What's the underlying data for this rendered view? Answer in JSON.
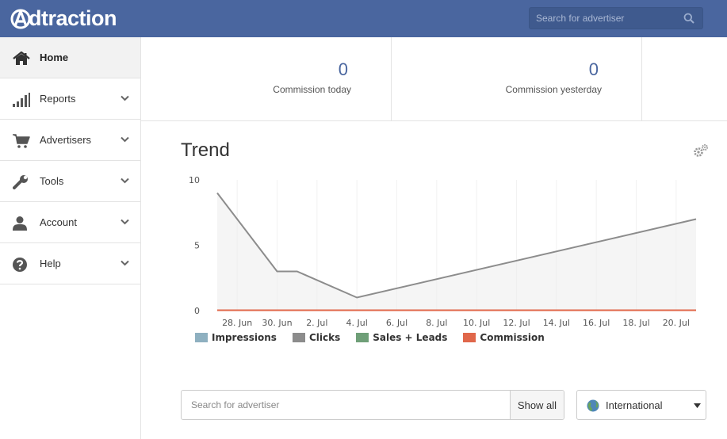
{
  "header": {
    "logo_text": "dtraction",
    "search_placeholder": "Search for advertiser",
    "accent_color": "#4a669f"
  },
  "sidebar": {
    "items": [
      {
        "label": "Home",
        "icon": "home-icon",
        "active": true
      },
      {
        "label": "Reports",
        "icon": "bar-signal-icon"
      },
      {
        "label": "Advertisers",
        "icon": "cart-icon"
      },
      {
        "label": "Tools",
        "icon": "wrench-icon"
      },
      {
        "label": "Account",
        "icon": "user-icon"
      },
      {
        "label": "Help",
        "icon": "question-icon"
      }
    ]
  },
  "stats": [
    {
      "value": "0",
      "label": "Commission today"
    },
    {
      "value": "0",
      "label": "Commission yesterday"
    }
  ],
  "trend": {
    "title": "Trend"
  },
  "chart_data": {
    "type": "area",
    "ylim": [
      0,
      10
    ],
    "yticks": [
      "10",
      "5",
      "0"
    ],
    "x_tick_labels": [
      "28. Jun",
      "30. Jun",
      "2. Jul",
      "4. Jul",
      "6. Jul",
      "8. Jul",
      "10. Jul",
      "12. Jul",
      "14. Jul",
      "16. Jul",
      "18. Jul",
      "20. Jul"
    ],
    "grid": false,
    "legend_position": "bottom-left",
    "series": [
      {
        "name": "Impressions",
        "color": "#8eb0c0",
        "points": []
      },
      {
        "name": "Clicks",
        "color": "#8c8c8c",
        "points": [
          {
            "x": "27. Jun",
            "y": 9
          },
          {
            "x": "30. Jun",
            "y": 3
          },
          {
            "x": "1. Jul",
            "y": 3
          },
          {
            "x": "4. Jul",
            "y": 1
          },
          {
            "x": "21. Jul",
            "y": 7
          }
        ]
      },
      {
        "name": "Sales + Leads",
        "color": "#6f9f78",
        "points": []
      },
      {
        "name": "Commission",
        "color": "#e0674a",
        "points": [
          {
            "x": "27. Jun",
            "y": 0
          },
          {
            "x": "21. Jul",
            "y": 0
          }
        ]
      }
    ]
  },
  "bottom": {
    "search_placeholder": "Search for advertiser",
    "show_all_label": "Show all",
    "region_label": "International"
  }
}
